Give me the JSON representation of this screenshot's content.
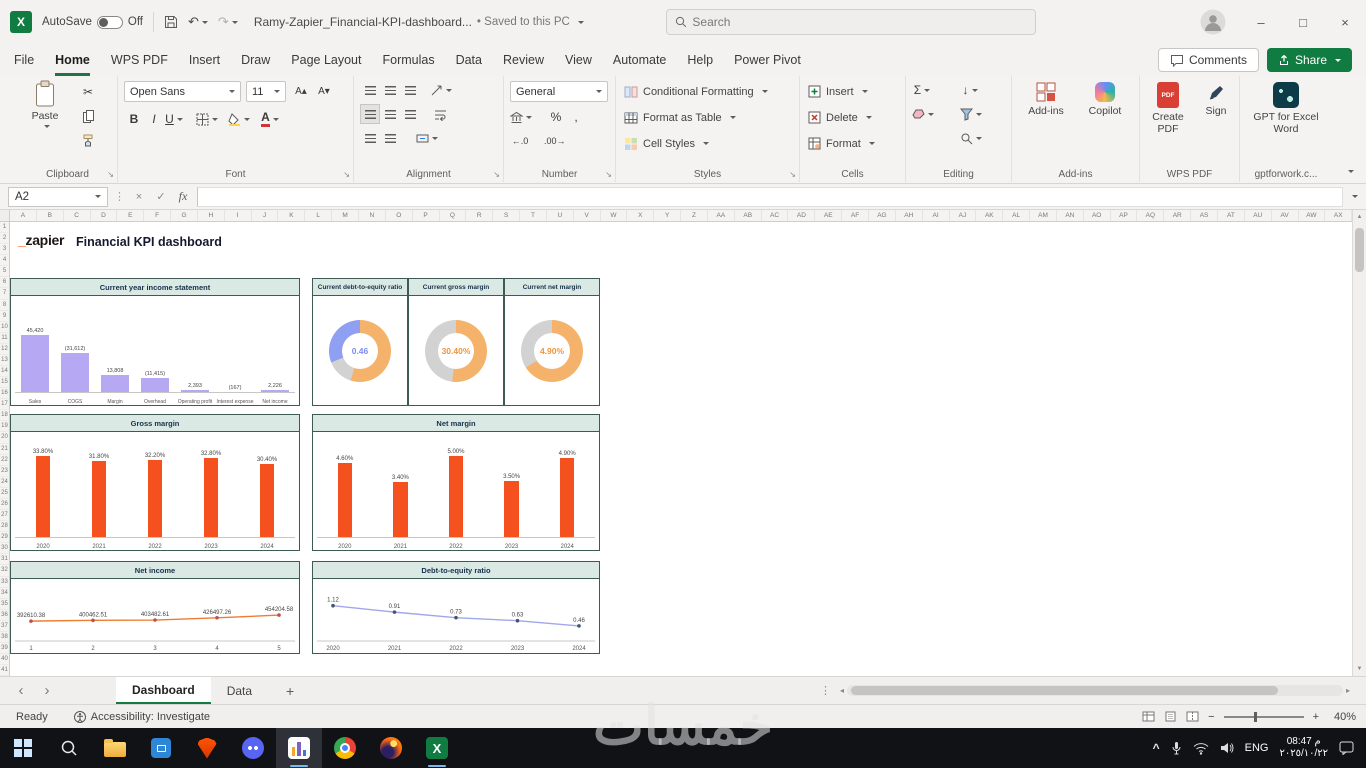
{
  "titlebar": {
    "autosave_label": "AutoSave",
    "autosave_state": "Off",
    "filename": "Ramy-Zapier_Financial-KPI-dashboard...",
    "dot": "•",
    "saved_status": "Saved to this PC",
    "search_placeholder": "Search"
  },
  "menubar": {
    "tabs": [
      "File",
      "Home",
      "WPS PDF",
      "Insert",
      "Draw",
      "Page Layout",
      "Formulas",
      "Data",
      "Review",
      "View",
      "Automate",
      "Help",
      "Power Pivot"
    ],
    "active_tab": "Home",
    "comments_label": "Comments",
    "share_label": "Share"
  },
  "ribbon": {
    "paste_label": "Paste",
    "font_name": "Open Sans",
    "font_size": "11",
    "number_format": "General",
    "conditional_formatting_label": "Conditional Formatting",
    "format_as_table_label": "Format as Table",
    "cell_styles_label": "Cell Styles",
    "insert_label": "Insert",
    "delete_label": "Delete",
    "format_label": "Format",
    "addins_label": "Add-ins",
    "copilot_label": "Copilot",
    "create_pdf_label": "Create PDF",
    "sign_label": "Sign",
    "gpt_label": "GPT for Excel Word",
    "groups": {
      "clipboard": "Clipboard",
      "font": "Font",
      "alignment": "Alignment",
      "number": "Number",
      "styles": "Styles",
      "cells": "Cells",
      "editing": "Editing",
      "addins": "Add-ins",
      "wpspdf": "WPS PDF",
      "gpt": "gptforwork.c..."
    }
  },
  "formula_bar": {
    "cell_ref": "A2",
    "fx": "fx",
    "value": ""
  },
  "sheet": {
    "columns": [
      "A",
      "B",
      "C",
      "D",
      "E",
      "F",
      "G",
      "H",
      "I",
      "J",
      "K",
      "L",
      "M",
      "N",
      "O",
      "P",
      "Q",
      "R",
      "S",
      "T",
      "U",
      "V",
      "W",
      "X",
      "Y",
      "Z",
      "AA",
      "AB",
      "AC",
      "AD",
      "AE",
      "AF",
      "AG",
      "AH",
      "AI",
      "AJ",
      "AK",
      "AL",
      "AM",
      "AN",
      "AO",
      "AP",
      "AQ",
      "AR",
      "AS",
      "AT",
      "AU",
      "AV",
      "AW",
      "AX"
    ],
    "row_count": 41,
    "logo_underscore": "_",
    "logo_text": "zapier",
    "dashboard_title": "Financial KPI dashboard"
  },
  "charts": {
    "income_statement": {
      "type": "bar",
      "title": "Current year income statement",
      "categories": [
        "Sales",
        "COGS",
        "Margin",
        "Overhead",
        "Operating profit",
        "Interest expense",
        "Net income"
      ],
      "values": [
        45420,
        -31612,
        13808,
        -11415,
        2393,
        -167,
        2226
      ],
      "labels": [
        "45,420",
        "(31,612)",
        "13,808",
        "(11,415)",
        "2,393",
        "(167)",
        "2,226"
      ],
      "bar_color": "#b6a8f3"
    },
    "kpi_donuts": [
      {
        "title": "Current debt-to-equity ratio",
        "value": "0.46",
        "value_color": "#7d8cf0",
        "segments": [
          {
            "color": "#f5b26b",
            "pct": 55
          },
          {
            "color": "#d2d2d2",
            "pct": 14
          },
          {
            "color": "#8f9ff2",
            "pct": 31
          }
        ]
      },
      {
        "title": "Current gross margin",
        "value": "30.40%",
        "value_color": "#f0943c",
        "segments": [
          {
            "color": "#f5b26b",
            "pct": 52
          },
          {
            "color": "#d2d2d2",
            "pct": 48
          }
        ]
      },
      {
        "title": "Current net margin",
        "value": "4.90%",
        "value_color": "#f0943c",
        "segments": [
          {
            "color": "#f5b26b",
            "pct": 66
          },
          {
            "color": "#d2d2d2",
            "pct": 34
          }
        ]
      }
    ],
    "gross_margin": {
      "type": "bar",
      "title": "Gross margin",
      "categories": [
        "2020",
        "2021",
        "2022",
        "2023",
        "2024"
      ],
      "values": [
        33.8,
        31.8,
        32.2,
        32.8,
        30.4
      ],
      "labels": [
        "33.80%",
        "31.80%",
        "32.20%",
        "32.80%",
        "30.40%"
      ],
      "bar_color": "#f4511e",
      "ylim": [
        0,
        34
      ]
    },
    "net_margin": {
      "type": "bar",
      "title": "Net margin",
      "categories": [
        "2020",
        "2021",
        "2022",
        "2023",
        "2024"
      ],
      "values": [
        4.6,
        3.4,
        5.0,
        3.5,
        4.9
      ],
      "labels": [
        "4.60%",
        "3.40%",
        "5.00%",
        "3.50%",
        "4.90%"
      ],
      "bar_color": "#f4511e",
      "ylim": [
        0,
        5
      ]
    },
    "net_income": {
      "type": "line",
      "title": "Net income",
      "x_labels": [
        "1",
        "2",
        "3",
        "4",
        "5"
      ],
      "values": [
        392610.38,
        400462.51,
        403482.61,
        426497.26,
        454204.58
      ],
      "labels": [
        "392610.38",
        "400462.51",
        "403482.61",
        "426497.26",
        "454204.58"
      ],
      "ymin": 200000,
      "ymax": 700000,
      "line_color": "#ed7d31",
      "marker_color": "#c0504d"
    },
    "debt_to_equity": {
      "type": "line",
      "title": "Debt-to-equity ratio",
      "x_labels": [
        "2020",
        "2021",
        "2022",
        "2023",
        "2024"
      ],
      "values": [
        1.12,
        0.91,
        0.73,
        0.63,
        0.46
      ],
      "labels": [
        "1.12",
        "0.91",
        "0.73",
        "0.63",
        "0.46"
      ],
      "ymin": 0,
      "ymax": 1.6,
      "line_color": "#9fa8ea",
      "marker_color": "#44546a"
    }
  },
  "sheet_tabs": {
    "tabs": [
      "Dashboard",
      "Data"
    ],
    "active_tab": "Dashboard",
    "add": "+"
  },
  "statusbar": {
    "ready": "Ready",
    "accessibility": "Accessibility: Investigate",
    "zoom": "40%"
  },
  "taskbar": {
    "language": "ENG",
    "time": "08:47 م",
    "date": "٢٠٢٥/١٠/٢٢"
  },
  "watermark": "خمسات",
  "glyphs": {
    "cut": "✂",
    "undo": "↶",
    "redo": "↷",
    "sum": "Σ",
    "percent": "%",
    "comma": ",",
    "dec_dec": "←.0",
    "dec_inc": ".00→",
    "bold": "B",
    "italic": "I",
    "underline": "U",
    "font_increase": "A▴",
    "font_decrease": "A▾",
    "fontcolor": "A",
    "fill_down": "↓",
    "check": "✓",
    "close": "×",
    "minimize": "–",
    "maximize": "□",
    "dots": "⋮",
    "nav_left": "‹",
    "nav_right": "›",
    "launcher": "↘",
    "up": "▲",
    "down": "▼",
    "hleft": "◂",
    "hright": "▸",
    "minus": "−",
    "plus": "+",
    "chevron": "^",
    "excel_x": "X"
  }
}
